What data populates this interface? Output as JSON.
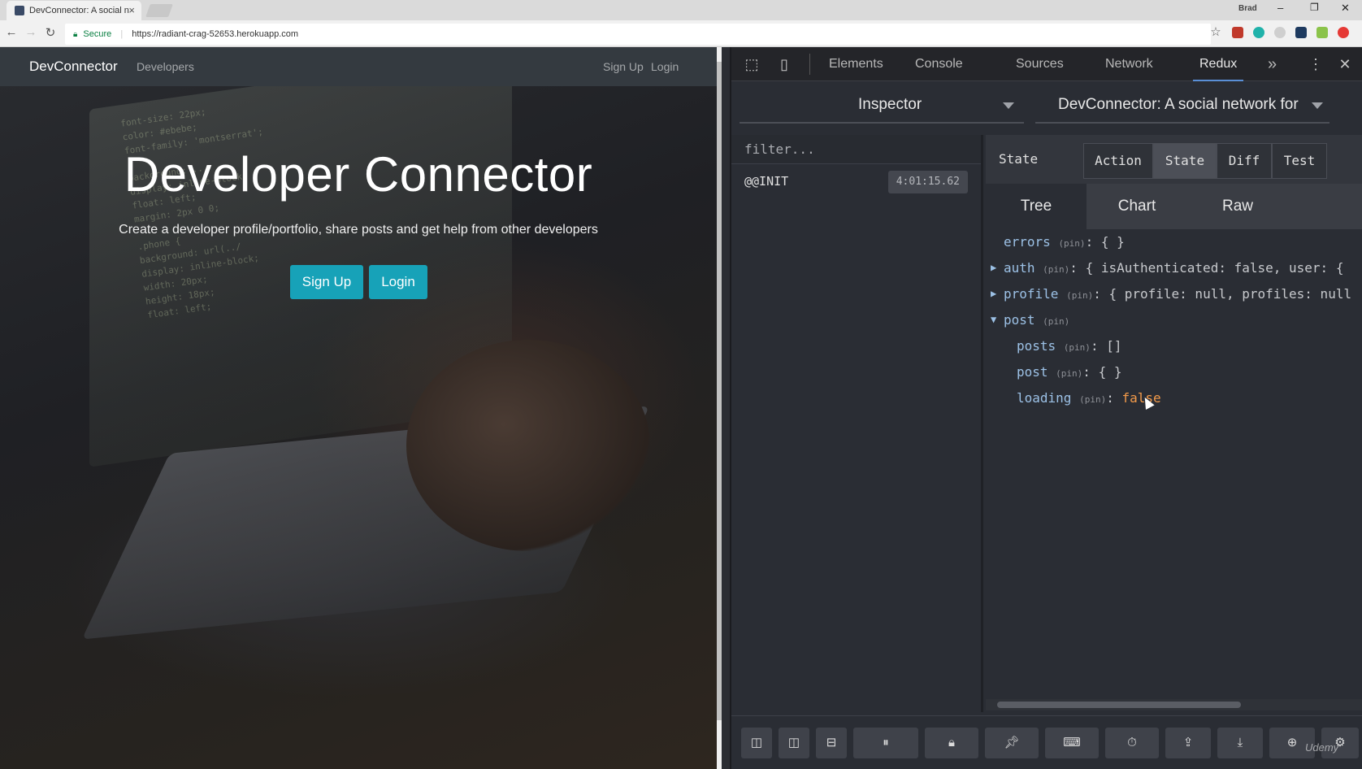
{
  "browser": {
    "tab_title": "DevConnector: A social n",
    "secure_label": "Secure",
    "url": "https://radiant-crag-52653.herokuapp.com",
    "user_label": "Brad",
    "minimize": "–",
    "restore": "❐",
    "close": "✕"
  },
  "site": {
    "brand": "DevConnector",
    "nav_developers": "Developers",
    "nav_signup": "Sign Up",
    "nav_login": "Login",
    "hero_title": "Developer Connector",
    "hero_subtitle": "Create a developer profile/portfolio, share posts and get help from other developers",
    "btn_signup": "Sign Up",
    "btn_login": "Login"
  },
  "devtools": {
    "tabs": [
      "Elements",
      "Console",
      "Sources",
      "Network",
      "Redux"
    ],
    "active_tab": "Redux",
    "more": "»",
    "menu": "⋮",
    "close": "✕"
  },
  "redux": {
    "monitor": "Inspector",
    "instance": "DevConnector: A social network for",
    "filter_placeholder": "filter...",
    "actions": [
      {
        "name": "@@INIT",
        "time": "4:01:15.62"
      }
    ],
    "panel_title": "State",
    "segments": [
      "Action",
      "State",
      "Diff",
      "Test"
    ],
    "active_segment": "State",
    "subtabs": [
      "Tree",
      "Chart",
      "Raw"
    ],
    "active_subtab": "Tree",
    "tree": [
      {
        "key": "errors",
        "pin": "(pin)",
        "value": ": { }"
      },
      {
        "key": "auth",
        "pin": "(pin)",
        "value": ": { isAuthenticated: false, user: {"
      },
      {
        "key": "profile",
        "pin": "(pin)",
        "value": ": { profile: null, profiles: null"
      },
      {
        "key": "post",
        "pin": "(pin)",
        "value": ""
      },
      {
        "key": "posts",
        "pin": "(pin)",
        "value": ": []"
      },
      {
        "key": "post",
        "pin": "(pin)",
        "value": ": { }"
      },
      {
        "key": "loading",
        "pin": "(pin)",
        "value": ": ",
        "bool": "false"
      }
    ]
  },
  "watermark": "Udemy"
}
